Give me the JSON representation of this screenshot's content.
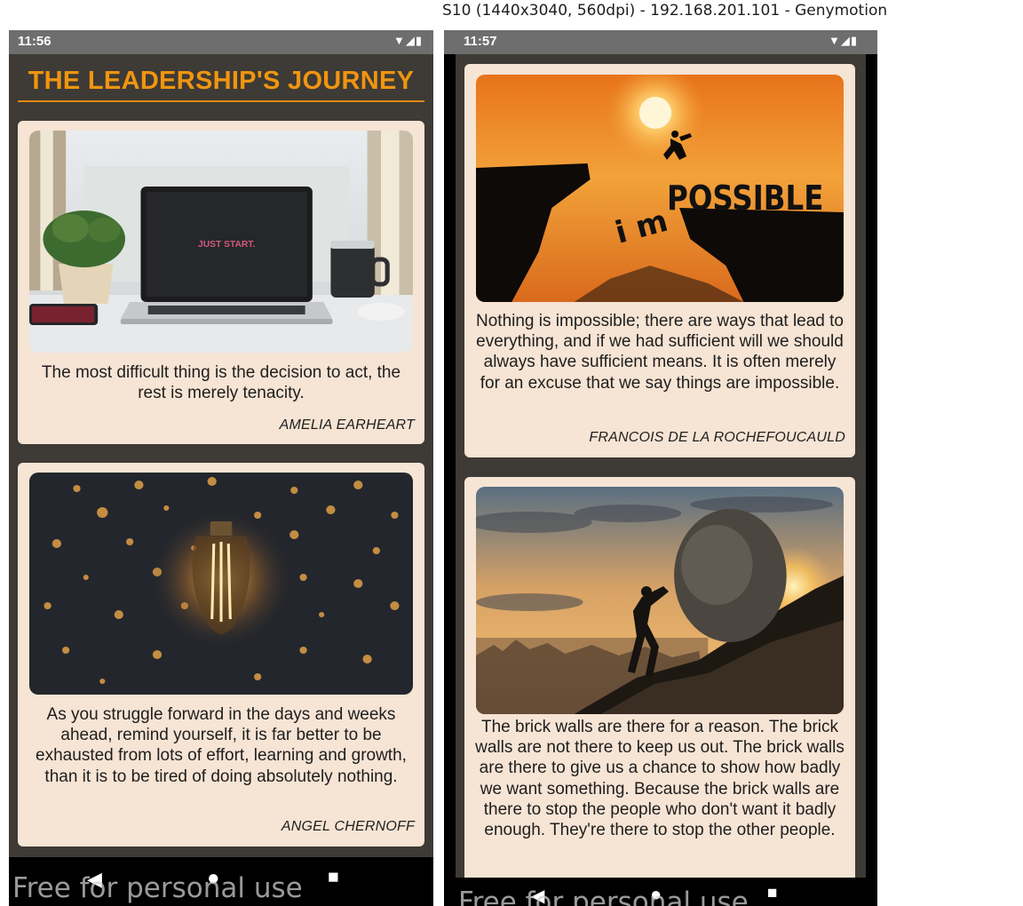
{
  "emulator": {
    "window_title": "S10 (1440x3040, 560dpi) - 192.168.201.101 - Genymotion"
  },
  "left_screen": {
    "status_time": "11:56",
    "status_icons": [
      "wifi-icon",
      "signal-icon",
      "battery-icon"
    ],
    "app_title": "THE LEADERSHIP'S JOURNEY",
    "cards": [
      {
        "image": "laptop-desk-photo",
        "image_text": "JUST START.",
        "quote": "The most difficult thing is the decision to act, the rest is merely tenacity.",
        "author": "AMELIA EARHEART"
      },
      {
        "image": "light-bulb-photo",
        "quote": "As you struggle forward in the days and weeks ahead, remind yourself, it is far better to be exhausted from lots of effort, learning and growth, than it is to be tired of doing absolutely nothing.",
        "author": "ANGEL CHERNOFF"
      }
    ],
    "nav": [
      "back-icon",
      "home-icon",
      "recents-icon"
    ],
    "watermark": "Free for personal use"
  },
  "right_screen": {
    "status_time": "11:57",
    "status_icons": [
      "wifi-icon",
      "signal-icon",
      "battery-icon"
    ],
    "cards": [
      {
        "image": "impossible-cliff-photo",
        "image_text_possible": "POSSIBLE",
        "image_text_im": "i m",
        "quote": "Nothing is impossible; there are ways that lead to everything, and if we had sufficient will we should always have sufficient means. It is often merely for an excuse that we say things are impossible.",
        "author": "FRANCOIS DE LA ROCHEFOUCAULD"
      },
      {
        "image": "boulder-push-photo",
        "quote": "The brick walls are there for a reason. The brick walls are not there to keep us out. The brick walls are there to give us a chance to show how badly we want something. Because the brick walls are there to stop the people who don't want it badly enough. They're there to stop the other people.",
        "author": ""
      }
    ],
    "nav": [
      "back-icon",
      "home-icon",
      "recents-icon"
    ],
    "watermark": "Free for personal use"
  },
  "colors": {
    "app_background": "#3e3a35",
    "title_orange": "#f09510",
    "card_background": "#f6e4d4",
    "status_bar": "#6e6e6e"
  }
}
